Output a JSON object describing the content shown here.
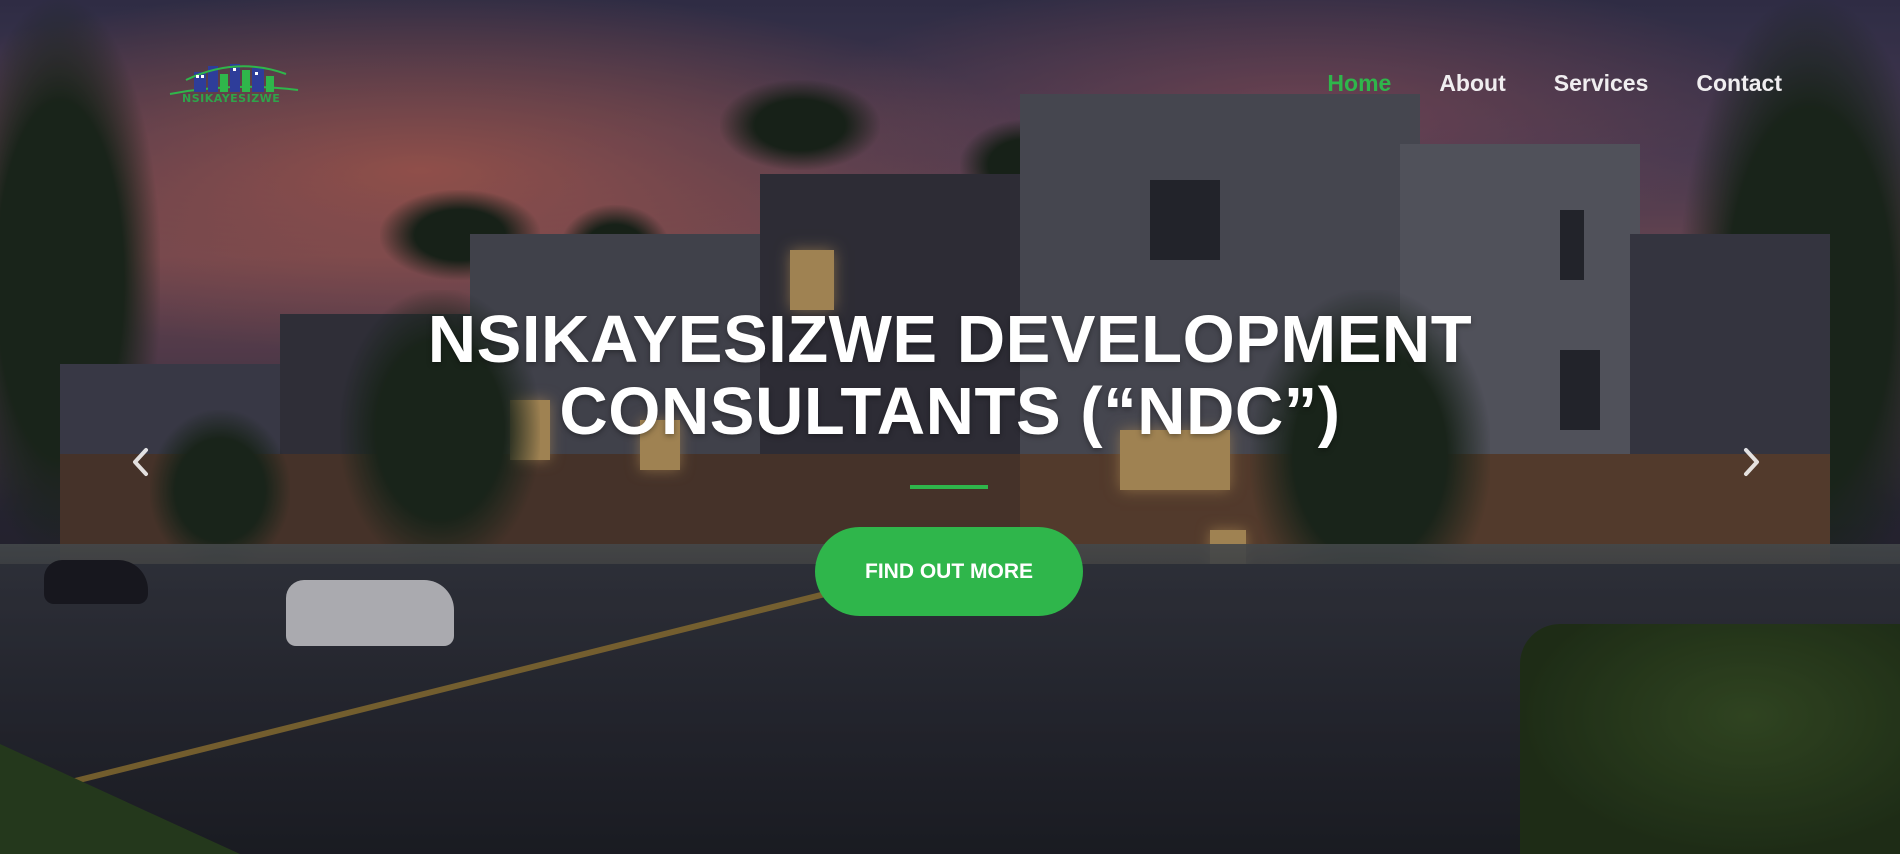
{
  "brand": {
    "logo_text": "NSIKAYESIZWE",
    "logo_icon": "city-skyline-icon"
  },
  "nav": {
    "items": [
      {
        "label": "Home",
        "active": true
      },
      {
        "label": "About",
        "active": false
      },
      {
        "label": "Services",
        "active": false
      },
      {
        "label": "Contact",
        "active": false
      }
    ]
  },
  "hero": {
    "title_line1": "NSIKAYESIZWE DEVELOPMENT",
    "title_line2": "CONSULTANTS (“NDC”)",
    "cta_label": "FIND OUT MORE",
    "prev_icon": "chevron-left-icon",
    "next_icon": "chevron-right-icon"
  },
  "colors": {
    "accent": "#2fb64b",
    "nav_text": "#f0eef0",
    "title_text": "#ffffff"
  }
}
